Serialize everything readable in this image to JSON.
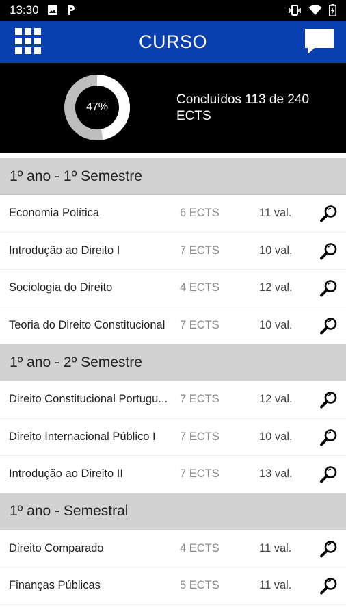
{
  "status_bar": {
    "time": "13:30",
    "icons_left": [
      "image-icon",
      "p-icon"
    ],
    "icons_right": [
      "vibrate-icon",
      "wifi-icon",
      "battery-icon"
    ]
  },
  "app_bar": {
    "title": "CURSO",
    "left_icon": "grid-menu-icon",
    "right_icon": "chat-icon",
    "color": "#0a3fb0"
  },
  "progress": {
    "percent_label": "47%",
    "percent": 47,
    "text": "Concluídos 113 de 240 ECTS",
    "ring_color": "#bdbdbd",
    "fill_color": "#ffffff"
  },
  "sections": [
    {
      "title": "1º ano - 1º Semestre",
      "courses": [
        {
          "name": "Economia Política",
          "ects": "6 ECTS",
          "grade": "11 val."
        },
        {
          "name": "Introdução ao Direito I",
          "ects": "7 ECTS",
          "grade": "10 val."
        },
        {
          "name": "Sociologia do Direito",
          "ects": "4 ECTS",
          "grade": "12 val."
        },
        {
          "name": "Teoria do Direito Constitucional",
          "ects": "7 ECTS",
          "grade": "10 val."
        }
      ]
    },
    {
      "title": "1º ano - 2º Semestre",
      "courses": [
        {
          "name": "Direito Constitucional Portugu...",
          "ects": "7 ECTS",
          "grade": "12 val."
        },
        {
          "name": "Direito Internacional Público I",
          "ects": "7 ECTS",
          "grade": "10 val."
        },
        {
          "name": "Introdução ao Direito II",
          "ects": "7 ECTS",
          "grade": "13 val."
        }
      ]
    },
    {
      "title": "1º ano - Semestral",
      "courses": [
        {
          "name": "Direito Comparado",
          "ects": "4 ECTS",
          "grade": "11 val."
        },
        {
          "name": "Finanças Públicas",
          "ects": "5 ECTS",
          "grade": "11 val."
        }
      ]
    }
  ]
}
